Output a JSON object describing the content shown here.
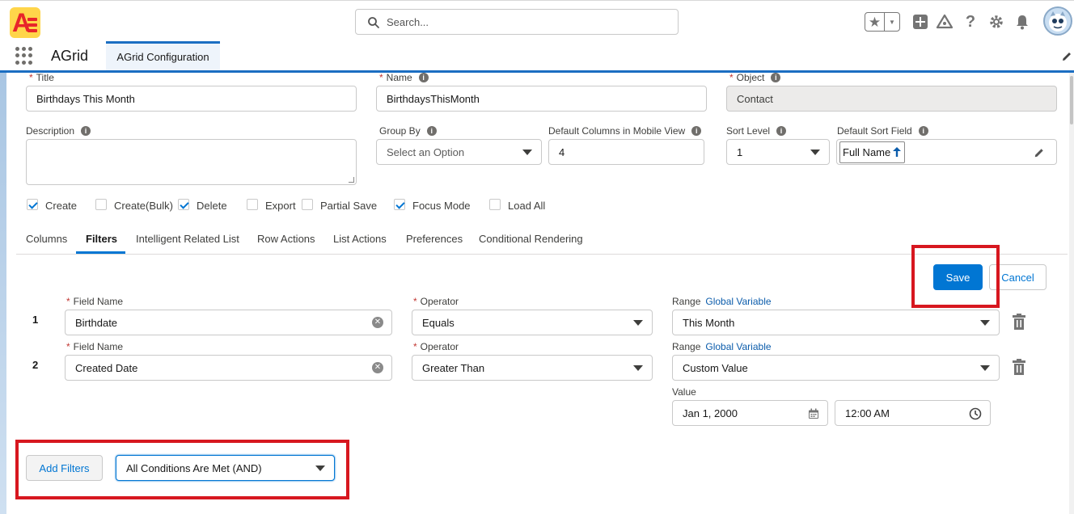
{
  "header": {
    "logo_letter": "A",
    "search_placeholder": "Search...",
    "icons": [
      "favorites-star-icon",
      "chevron-down-icon",
      "add-icon",
      "trailhead-icon",
      "help-icon",
      "setup-gear-icon",
      "notifications-bell-icon",
      "user-avatar"
    ]
  },
  "nav": {
    "app_name": "AGrid",
    "tab_label": "AGrid Configuration"
  },
  "form": {
    "title": {
      "label": "Title",
      "value": "Birthdays This Month"
    },
    "name": {
      "label": "Name",
      "value": "BirthdaysThisMonth"
    },
    "object": {
      "label": "Object",
      "value": "Contact"
    },
    "description": {
      "label": "Description",
      "value": ""
    },
    "group_by": {
      "label": "Group By",
      "placeholder": "Select an Option"
    },
    "default_columns_mobile": {
      "label": "Default Columns in Mobile View",
      "value": "4"
    },
    "sort_level": {
      "label": "Sort Level",
      "value": "1"
    },
    "default_sort_field": {
      "label": "Default Sort Field",
      "value": "Full Name"
    }
  },
  "checkboxes": [
    {
      "label": "Create",
      "checked": true
    },
    {
      "label": "Create(Bulk)",
      "checked": false
    },
    {
      "label": "Delete",
      "checked": true
    },
    {
      "label": "Export",
      "checked": false
    },
    {
      "label": "Partial Save",
      "checked": false
    },
    {
      "label": "Focus Mode",
      "checked": true
    },
    {
      "label": "Load All",
      "checked": false
    }
  ],
  "tabs": [
    "Columns",
    "Filters",
    "Intelligent Related List",
    "Row Actions",
    "List Actions",
    "Preferences",
    "Conditional Rendering"
  ],
  "active_tab": "Filters",
  "actions": {
    "save": "Save",
    "cancel": "Cancel"
  },
  "filters": [
    {
      "number": "1",
      "field_label": "Field Name",
      "field_value": "Birthdate",
      "operator_label": "Operator",
      "operator_value": "Equals",
      "range_label": "Range",
      "range_link": "Global Variable",
      "range_value": "This Month"
    },
    {
      "number": "2",
      "field_label": "Field Name",
      "field_value": "Created Date",
      "operator_label": "Operator",
      "operator_value": "Greater Than",
      "range_label": "Range",
      "range_link": "Global Variable",
      "range_value": "Custom Value",
      "value_label": "Value",
      "date_value": "Jan 1, 2000",
      "time_value": "12:00 AM"
    }
  ],
  "footer": {
    "add_filters": "Add Filters",
    "logic_value": "All Conditions Are Met (AND)"
  },
  "colors": {
    "brand_blue": "#0176d3",
    "highlight_red": "#d7171f",
    "required_red": "#c23934"
  }
}
